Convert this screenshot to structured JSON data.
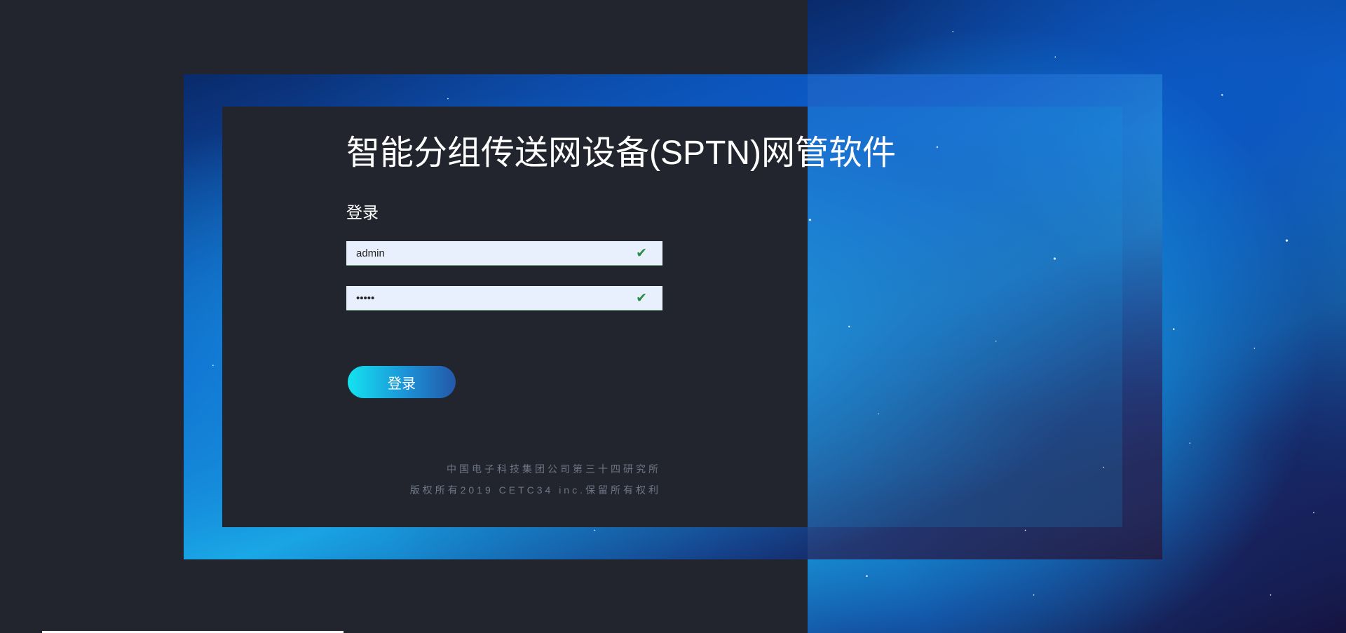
{
  "header": {
    "title": "智能分组传送网设备(SPTN)网管软件"
  },
  "login": {
    "heading": "登录",
    "username_value": "admin",
    "password_value": "•••••",
    "check_glyph": "✔",
    "button_label": "登录"
  },
  "footer": {
    "line1": "中国电子科技集团公司第三十四研究所",
    "line2": "版权所有2019 CETC34 inc.保留所有权利"
  },
  "colors": {
    "background": "#22242e",
    "accent_start": "#14e2f0",
    "accent_end": "#2358a8",
    "check": "#2e8b46"
  },
  "icons": {
    "field_status": "check-icon"
  }
}
